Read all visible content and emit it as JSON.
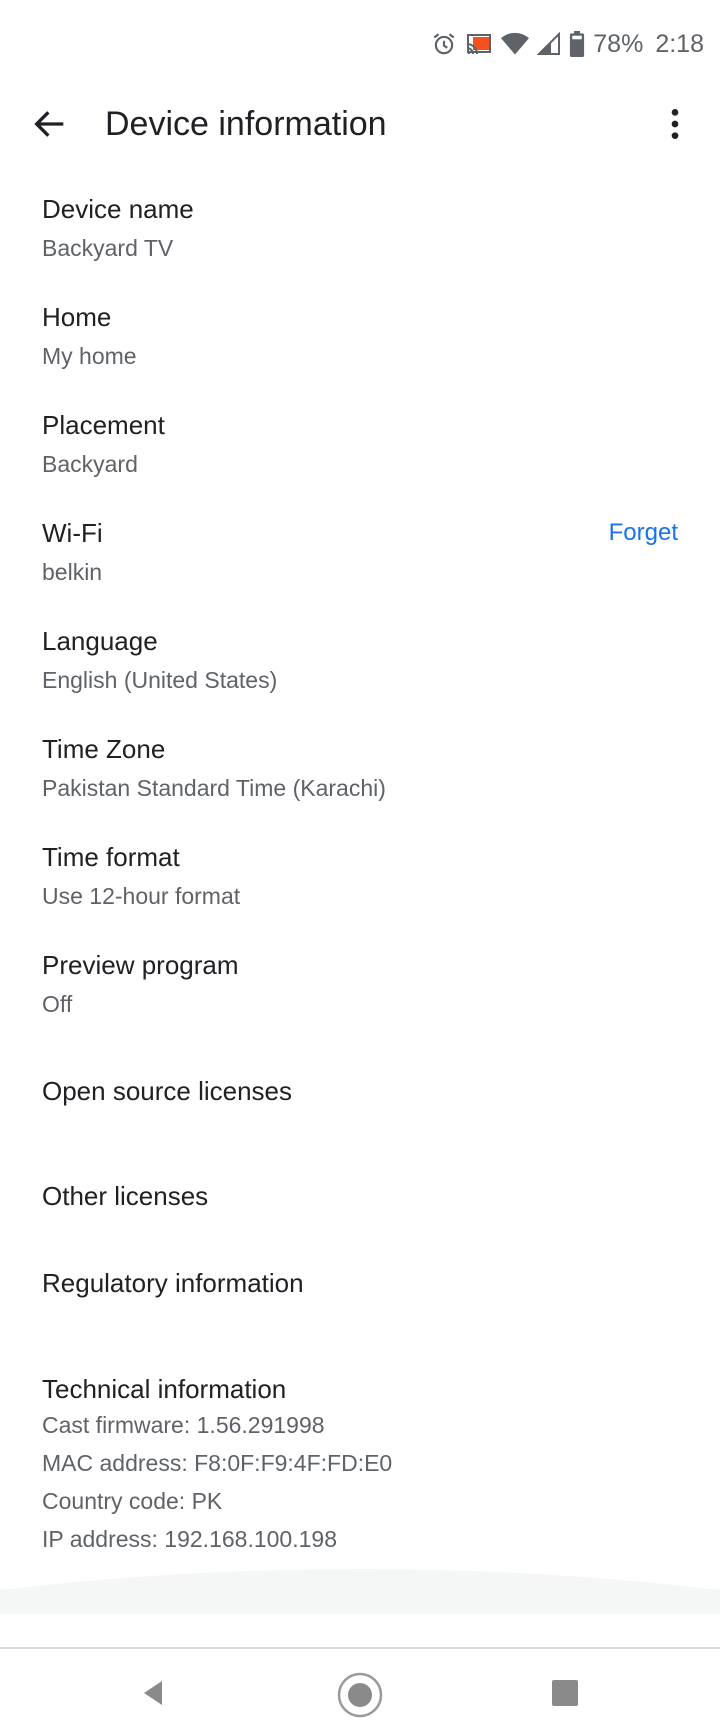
{
  "status_bar": {
    "icons": [
      "alarm-icon",
      "cast-icon",
      "wifi-icon",
      "cellular-signal-icon",
      "battery-icon"
    ],
    "battery": "78%",
    "time": "2:18",
    "cast_color": "#f4511e"
  },
  "app_bar": {
    "title": "Device information",
    "back_icon": "arrow-back-icon",
    "menu_icon": "more-vert-icon"
  },
  "settings": [
    {
      "title": "Device name",
      "value": "Backyard TV"
    },
    {
      "title": "Home",
      "value": "My home"
    },
    {
      "title": "Placement",
      "value": "Backyard"
    },
    {
      "title": "Wi-Fi",
      "value": "belkin",
      "action": "Forget"
    },
    {
      "title": "Language",
      "value": "English (United States)"
    },
    {
      "title": "Time Zone",
      "value": "Pakistan Standard Time (Karachi)"
    },
    {
      "title": "Time format",
      "value": "Use 12-hour format"
    },
    {
      "title": "Preview program",
      "value": "Off"
    }
  ],
  "links": [
    {
      "title": "Open source licenses"
    },
    {
      "title": "Other licenses"
    },
    {
      "title": "Regulatory information"
    }
  ],
  "technical": {
    "title": "Technical information",
    "lines": [
      "Cast firmware: 1.56.291998",
      "MAC address: F8:0F:F9:4F:FD:E0",
      "Country code: PK",
      "IP address: 192.168.100.198"
    ]
  },
  "colors": {
    "accent": "#1a73e8",
    "primary_text": "#202124",
    "secondary_text": "#5f6368"
  },
  "nav_bar": {
    "buttons": [
      "nav-back-icon",
      "nav-home-icon",
      "nav-recents-icon"
    ]
  }
}
